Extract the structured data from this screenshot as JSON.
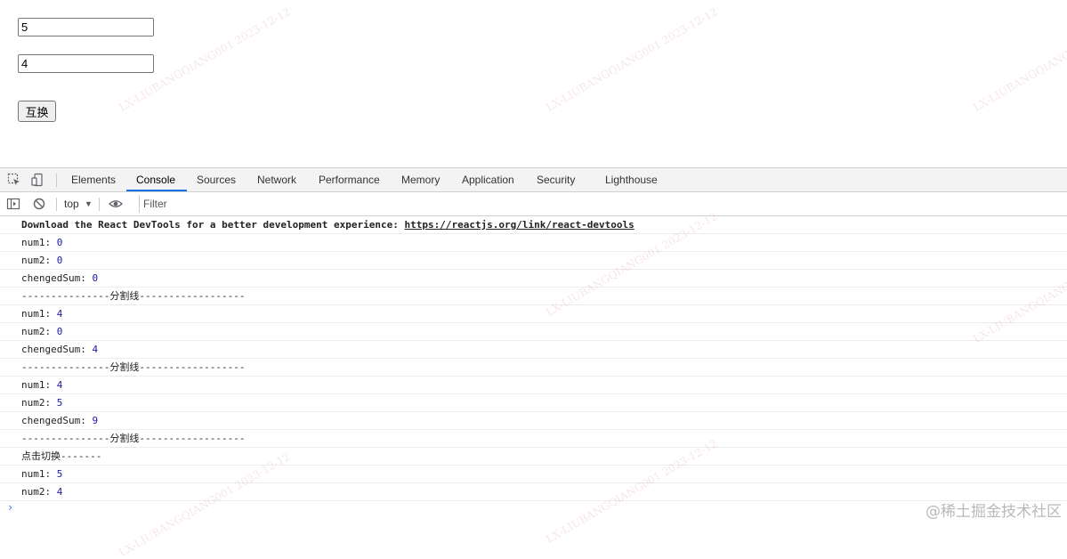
{
  "page": {
    "input1_value": "5",
    "input2_value": "4",
    "swap_button_label": "互换"
  },
  "devtools": {
    "tabs": [
      "Elements",
      "Console",
      "Sources",
      "Network",
      "Performance",
      "Memory",
      "Application",
      "Security",
      "Lighthouse"
    ],
    "active_tab": "Console",
    "context_selector": "top",
    "filter_placeholder": "Filter",
    "accent_color": "#1a73e8",
    "value_color": "#1a1aa6"
  },
  "console": {
    "devtools_notice": {
      "text": "Download the React DevTools for a better development experience: ",
      "link": "https://reactjs.org/link/react-devtools"
    },
    "lines": [
      {
        "label": "num1: ",
        "value": "0"
      },
      {
        "label": "num2: ",
        "value": "0"
      },
      {
        "label": "chengedSum: ",
        "value": "0"
      },
      {
        "label": "---------------分割线------------------",
        "value": ""
      },
      {
        "label": "num1: ",
        "value": "4"
      },
      {
        "label": "num2: ",
        "value": "0"
      },
      {
        "label": "chengedSum: ",
        "value": "4"
      },
      {
        "label": "---------------分割线------------------",
        "value": ""
      },
      {
        "label": "num1: ",
        "value": "4"
      },
      {
        "label": "num2: ",
        "value": "5"
      },
      {
        "label": "chengedSum: ",
        "value": "9"
      },
      {
        "label": "---------------分割线------------------",
        "value": ""
      },
      {
        "label": "点击切换-------",
        "value": ""
      },
      {
        "label": "num1: ",
        "value": "5"
      },
      {
        "label": "num2: ",
        "value": "4"
      }
    ],
    "prompt_symbol": "›"
  },
  "watermark": {
    "corner_text": "@稀土掘金技术社区",
    "diagonal_text": "LX-LIUBANGQIANG001 2023-12-12"
  }
}
